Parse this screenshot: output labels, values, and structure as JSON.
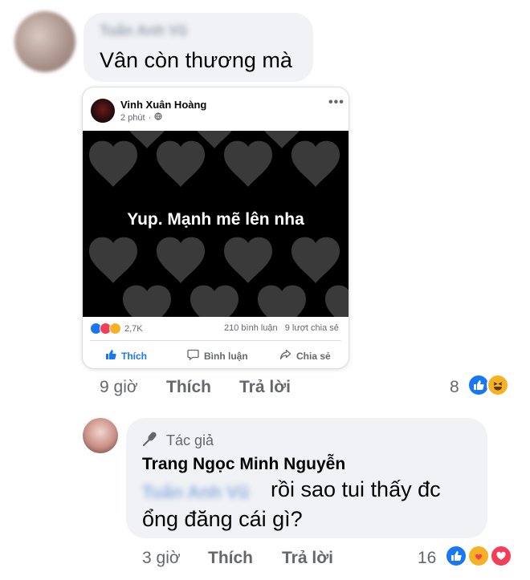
{
  "comment1": {
    "author": "Tuấn Anh Vũ",
    "text": "Vân còn thương mà",
    "time": "9 giờ",
    "like_label": "Thích",
    "reply_label": "Trả lời",
    "reaction_count": "8"
  },
  "shared_post": {
    "author": "Vinh Xuân Hoàng",
    "time": "2 phút",
    "status_text": "Yup. Mạnh mẽ lên nha",
    "reactions_count": "2,7K",
    "comments_count": "210 bình luận",
    "shares_count": "9 lượt chia sẻ",
    "like_label": "Thích",
    "comment_label": "Bình luận",
    "share_label": "Chia sẻ"
  },
  "comment2": {
    "badge": "Tác giả",
    "author": "Trang Ngọc Minh Nguyễn",
    "mention": "Tuấn Anh Vũ",
    "text_line1": "rồi sao tui thấy đc",
    "text_line2": "ổng đăng cái gì?",
    "time": "3 giờ",
    "like_label": "Thích",
    "reply_label": "Trả lời",
    "reaction_count": "16"
  },
  "colors": {
    "accent": "#1877f2",
    "bubble": "#f0f2f5",
    "meta": "#65676b",
    "love": "#f33e58",
    "haha": "#f7b125"
  }
}
